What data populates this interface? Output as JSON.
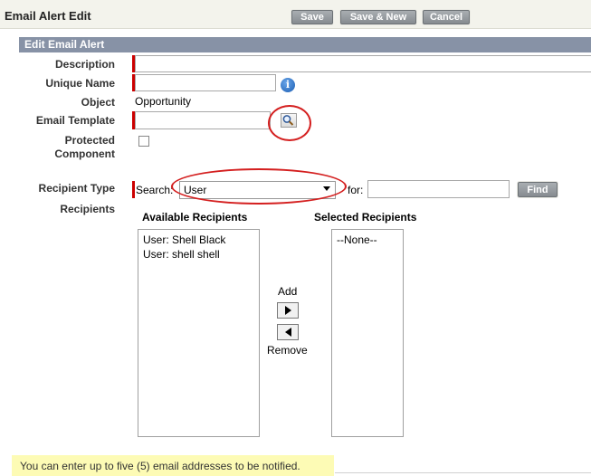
{
  "header": {
    "title": "Email Alert Edit",
    "save": "Save",
    "save_new": "Save & New",
    "cancel": "Cancel"
  },
  "section": {
    "title": "Edit Email Alert"
  },
  "fields": {
    "description_label": "Description",
    "unique_name_label": "Unique Name",
    "object_label": "Object",
    "object_value": "Opportunity",
    "email_template_label": "Email Template",
    "protected_label_1": "Protected",
    "protected_label_2": "Component",
    "recipient_type_label": "Recipient Type",
    "recipients_label": "Recipients",
    "search_label": "Search:",
    "search_value": "User",
    "for_label": "for:",
    "find": "Find"
  },
  "recipients": {
    "available_title": "Available Recipients",
    "selected_title": "Selected Recipients",
    "available": [
      "User: Shell Black",
      "User: shell shell"
    ],
    "selected": [
      "--None--"
    ],
    "add_label": "Add",
    "remove_label": "Remove"
  },
  "footer": {
    "note": "You can enter up to five (5) email addresses to be notified."
  },
  "icons": {
    "info": "info-icon",
    "lookup": "lookup-icon",
    "add_arrow": "arrow-right-icon",
    "remove_arrow": "arrow-left-icon"
  },
  "colors": {
    "required": "#cc0000",
    "highlight": "#d41f1f",
    "section": "#8792a6",
    "note_bg": "#fdfbb5"
  }
}
